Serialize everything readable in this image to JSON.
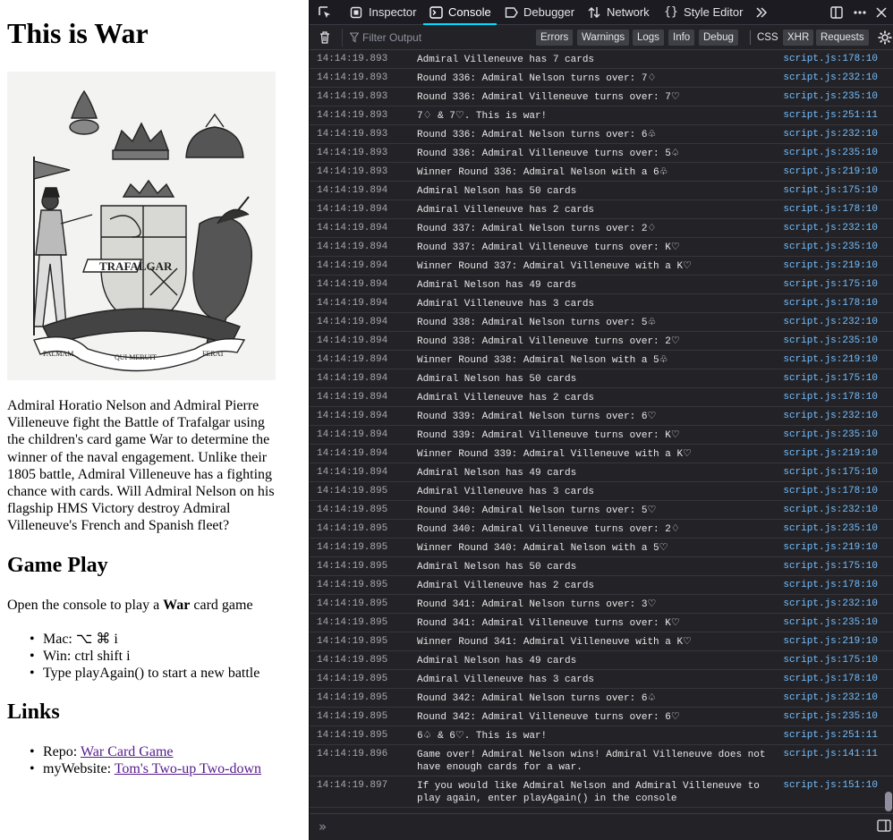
{
  "page": {
    "title": "This is War",
    "intro": "Admiral Horatio Nelson and Admiral Pierre Villeneuve fight the Battle of Trafalgar using the children's card game War to determine the winner of the naval engagement. Unlike their 1805 battle, Admiral Villeneuve has a fighting chance with cards. Will Admiral Nelson on his flagship HMS Victory destroy Admiral Villeneuve's French and Spanish fleet?",
    "hero": {
      "banner": "TRAFALGAR",
      "motto": [
        "PALMAM",
        "QUI MERUIT",
        "FERAT"
      ]
    },
    "gameplay": {
      "heading": "Game Play",
      "text_before": "Open the console to play a ",
      "text_bold": "War",
      "text_after": " card game",
      "items": [
        "Mac: ⌥ ⌘ i",
        "Win: ctrl shift i",
        "Type playAgain() to start a new battle"
      ]
    },
    "links": {
      "heading": "Links",
      "items": [
        {
          "label": "Repo: ",
          "link": "War Card Game"
        },
        {
          "label": "myWebsite: ",
          "link": "Tom's Two-up Two-down"
        }
      ]
    }
  },
  "devtools": {
    "tabs": [
      {
        "label": "Inspector",
        "icon": "inspector-icon"
      },
      {
        "label": "Console",
        "icon": "console-icon"
      },
      {
        "label": "Debugger",
        "icon": "debugger-icon"
      },
      {
        "label": "Network",
        "icon": "network-icon"
      },
      {
        "label": "Style Editor",
        "icon": "style-editor-icon"
      }
    ],
    "active_tab": "Console",
    "filter_placeholder": "Filter Output",
    "filter_buttons": [
      "Errors",
      "Warnings",
      "Logs",
      "Info",
      "Debug"
    ],
    "filter_buttons_right": [
      "CSS",
      "XHR",
      "Requests"
    ],
    "colors": {
      "accent": "#00ddff",
      "source_link": "#75bfff",
      "background": "#232327"
    },
    "log": [
      {
        "ts": "14:14:19.893",
        "msg": "Admiral Villeneuve has 7 cards",
        "src": "script.js:178:10"
      },
      {
        "ts": "14:14:19.893",
        "msg": "Round 336: Admiral Nelson turns over: 7♢",
        "src": "script.js:232:10"
      },
      {
        "ts": "14:14:19.893",
        "msg": "Round 336: Admiral Villeneuve turns over: 7♡",
        "src": "script.js:235:10"
      },
      {
        "ts": "14:14:19.893",
        "msg": "7♢ & 7♡. This is war!",
        "src": "script.js:251:11"
      },
      {
        "ts": "14:14:19.893",
        "msg": "Round 336: Admiral Nelson turns over: 6♧",
        "src": "script.js:232:10"
      },
      {
        "ts": "14:14:19.893",
        "msg": "Round 336: Admiral Villeneuve turns over: 5♤",
        "src": "script.js:235:10"
      },
      {
        "ts": "14:14:19.893",
        "msg": "Winner Round 336: Admiral Nelson with a 6♧",
        "src": "script.js:219:10"
      },
      {
        "ts": "14:14:19.894",
        "msg": "Admiral Nelson has 50 cards",
        "src": "script.js:175:10"
      },
      {
        "ts": "14:14:19.894",
        "msg": "Admiral Villeneuve has 2 cards",
        "src": "script.js:178:10"
      },
      {
        "ts": "14:14:19.894",
        "msg": "Round 337: Admiral Nelson turns over: 2♢",
        "src": "script.js:232:10"
      },
      {
        "ts": "14:14:19.894",
        "msg": "Round 337: Admiral Villeneuve turns over: K♡",
        "src": "script.js:235:10"
      },
      {
        "ts": "14:14:19.894",
        "msg": "Winner Round 337: Admiral Villeneuve with a K♡",
        "src": "script.js:219:10"
      },
      {
        "ts": "14:14:19.894",
        "msg": "Admiral Nelson has 49 cards",
        "src": "script.js:175:10"
      },
      {
        "ts": "14:14:19.894",
        "msg": "Admiral Villeneuve has 3 cards",
        "src": "script.js:178:10"
      },
      {
        "ts": "14:14:19.894",
        "msg": "Round 338: Admiral Nelson turns over: 5♧",
        "src": "script.js:232:10"
      },
      {
        "ts": "14:14:19.894",
        "msg": "Round 338: Admiral Villeneuve turns over: 2♡",
        "src": "script.js:235:10"
      },
      {
        "ts": "14:14:19.894",
        "msg": "Winner Round 338: Admiral Nelson with a 5♧",
        "src": "script.js:219:10"
      },
      {
        "ts": "14:14:19.894",
        "msg": "Admiral Nelson has 50 cards",
        "src": "script.js:175:10"
      },
      {
        "ts": "14:14:19.894",
        "msg": "Admiral Villeneuve has 2 cards",
        "src": "script.js:178:10"
      },
      {
        "ts": "14:14:19.894",
        "msg": "Round 339: Admiral Nelson turns over: 6♡",
        "src": "script.js:232:10"
      },
      {
        "ts": "14:14:19.894",
        "msg": "Round 339: Admiral Villeneuve turns over: K♡",
        "src": "script.js:235:10"
      },
      {
        "ts": "14:14:19.894",
        "msg": "Winner Round 339: Admiral Villeneuve with a K♡",
        "src": "script.js:219:10"
      },
      {
        "ts": "14:14:19.894",
        "msg": "Admiral Nelson has 49 cards",
        "src": "script.js:175:10"
      },
      {
        "ts": "14:14:19.895",
        "msg": "Admiral Villeneuve has 3 cards",
        "src": "script.js:178:10"
      },
      {
        "ts": "14:14:19.895",
        "msg": "Round 340: Admiral Nelson turns over: 5♡",
        "src": "script.js:232:10"
      },
      {
        "ts": "14:14:19.895",
        "msg": "Round 340: Admiral Villeneuve turns over: 2♢",
        "src": "script.js:235:10"
      },
      {
        "ts": "14:14:19.895",
        "msg": "Winner Round 340: Admiral Nelson with a 5♡",
        "src": "script.js:219:10"
      },
      {
        "ts": "14:14:19.895",
        "msg": "Admiral Nelson has 50 cards",
        "src": "script.js:175:10"
      },
      {
        "ts": "14:14:19.895",
        "msg": "Admiral Villeneuve has 2 cards",
        "src": "script.js:178:10"
      },
      {
        "ts": "14:14:19.895",
        "msg": "Round 341: Admiral Nelson turns over: 3♡",
        "src": "script.js:232:10"
      },
      {
        "ts": "14:14:19.895",
        "msg": "Round 341: Admiral Villeneuve turns over: K♡",
        "src": "script.js:235:10"
      },
      {
        "ts": "14:14:19.895",
        "msg": "Winner Round 341: Admiral Villeneuve with a K♡",
        "src": "script.js:219:10"
      },
      {
        "ts": "14:14:19.895",
        "msg": "Admiral Nelson has 49 cards",
        "src": "script.js:175:10"
      },
      {
        "ts": "14:14:19.895",
        "msg": "Admiral Villeneuve has 3 cards",
        "src": "script.js:178:10"
      },
      {
        "ts": "14:14:19.895",
        "msg": "Round 342: Admiral Nelson turns over: 6♤",
        "src": "script.js:232:10"
      },
      {
        "ts": "14:14:19.895",
        "msg": "Round 342: Admiral Villeneuve turns over: 6♡",
        "src": "script.js:235:10"
      },
      {
        "ts": "14:14:19.895",
        "msg": "6♤ & 6♡. This is war!",
        "src": "script.js:251:11"
      },
      {
        "ts": "14:14:19.896",
        "msg": "Game over! Admiral Nelson wins! Admiral Villeneuve does not have enough cards for a war.",
        "src": "script.js:141:11"
      },
      {
        "ts": "14:14:19.897",
        "msg": "If you would like Admiral Nelson and Admiral Villeneuve to play again, enter playAgain() in the console",
        "src": "script.js:151:10"
      }
    ]
  }
}
